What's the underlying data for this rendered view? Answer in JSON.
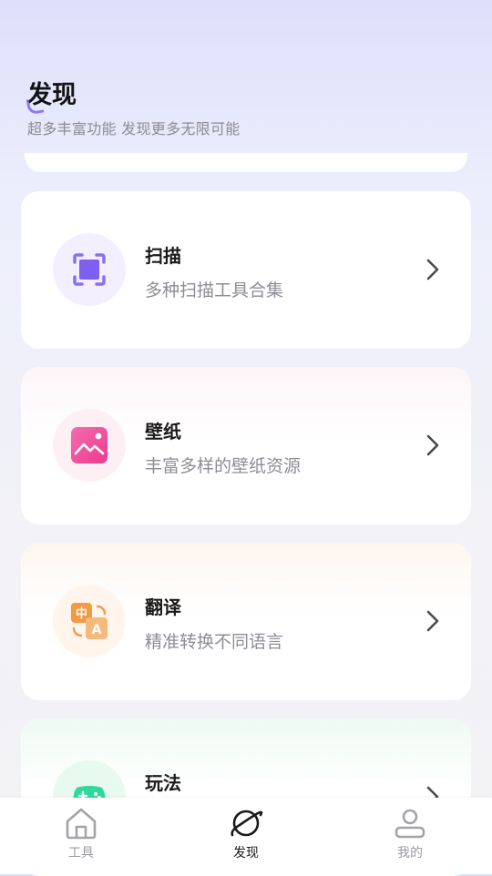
{
  "header": {
    "title": "发现",
    "subtitle": "超多丰富功能  发现更多无限可能"
  },
  "cards": [
    {
      "title": "扫描",
      "desc": "多种扫描工具合集",
      "icon": "scan-icon"
    },
    {
      "title": "壁纸",
      "desc": "丰富多样的壁纸资源",
      "icon": "wallpaper-icon"
    },
    {
      "title": "翻译",
      "desc": "精准转换不同语言",
      "icon": "translate-icon"
    },
    {
      "title": "玩法",
      "desc": "",
      "icon": "gamepad-icon"
    }
  ],
  "tabbar": {
    "tabs": [
      {
        "label": "工具",
        "icon": "home-icon",
        "active": false
      },
      {
        "label": "发现",
        "icon": "planet-icon",
        "active": true
      },
      {
        "label": "我的",
        "icon": "user-icon",
        "active": false
      }
    ]
  },
  "colors": {
    "accent_purple": "#7b5cf0",
    "wallpaper_pink": "#f0479a",
    "translate_orange": "#f5a052",
    "game_green": "#2fd99a"
  }
}
